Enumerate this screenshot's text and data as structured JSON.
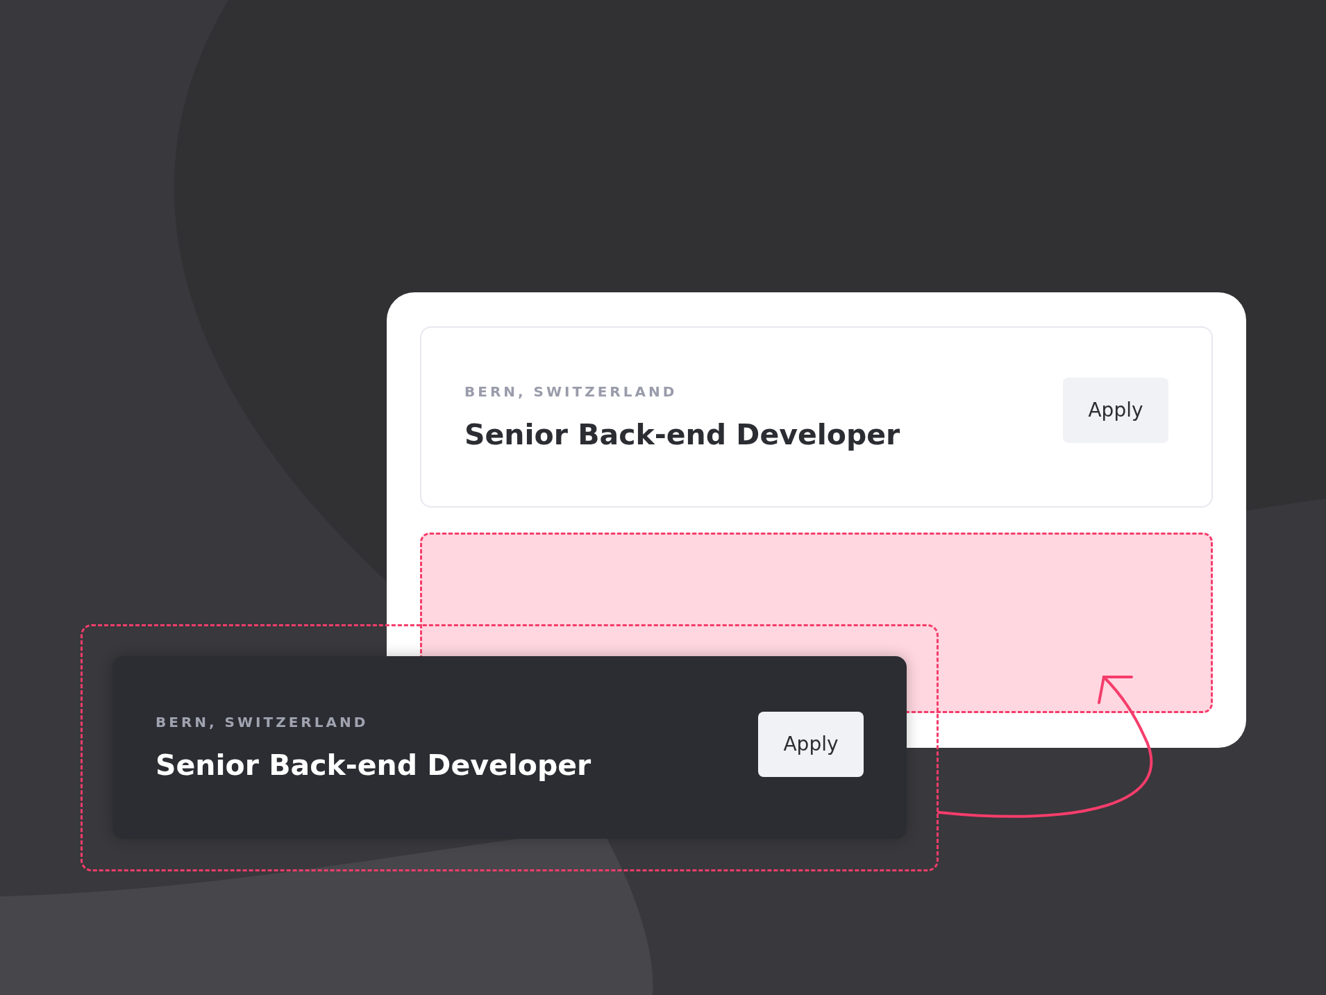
{
  "placed_card": {
    "location": "BERN, SWITZERLAND",
    "title": "Senior Back-end Developer",
    "button": "Apply"
  },
  "dragged_card": {
    "location": "BERN, SWITZERLAND",
    "title": "Senior Back-end Developer",
    "button": "Apply"
  }
}
